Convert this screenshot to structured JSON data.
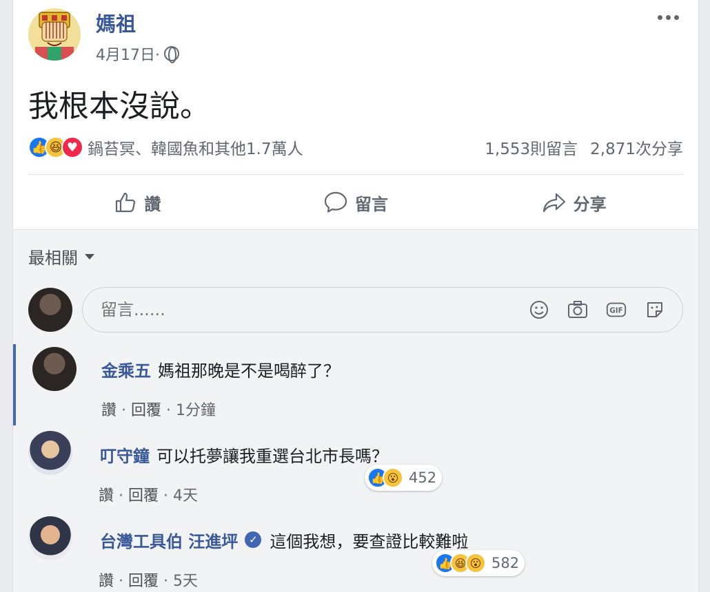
{
  "post": {
    "page_name": "媽祖",
    "date": "4月17日·",
    "text": "我根本沒說。",
    "reaction_names": "鍋苔冥、韓國魚和其他1.7萬人",
    "comment_count": "1,553則留言",
    "share_count": "2,871次分享"
  },
  "actions": {
    "like": "讚",
    "comment": "留言",
    "share": "分享"
  },
  "comments_section": {
    "sort_label": "最相關",
    "input_placeholder": "留言......",
    "input_icons": [
      "emoji-icon",
      "camera-icon",
      "gif-icon",
      "sticker-icon"
    ],
    "gif_label": "GIF"
  },
  "comments": [
    {
      "name": "金乘五",
      "text": "媽祖那晚是不是喝醉了？",
      "like": "讚",
      "reply": "回覆",
      "time": "1分鐘",
      "reactions": null
    },
    {
      "name": "叮守鐘",
      "text": "可以托夢讓我重選台北市長嗎？",
      "like": "讚",
      "reply": "回覆",
      "time": "4天",
      "reactions": {
        "count": "452",
        "icons": [
          "like",
          "wow"
        ]
      }
    },
    {
      "name": "台灣工具伯 汪進坪",
      "verified": true,
      "text": "這個我想，要查證比較難啦",
      "like": "讚",
      "reply": "回覆",
      "time": "5天",
      "reactions": {
        "count": "582",
        "icons": [
          "like",
          "haha",
          "wow"
        ]
      }
    }
  ],
  "colors": {
    "link_blue": "#385898",
    "like_blue": "#1877f2",
    "love_red": "#f0284a",
    "haha_yellow": "#f7c33c",
    "meta_gray": "#606770"
  }
}
